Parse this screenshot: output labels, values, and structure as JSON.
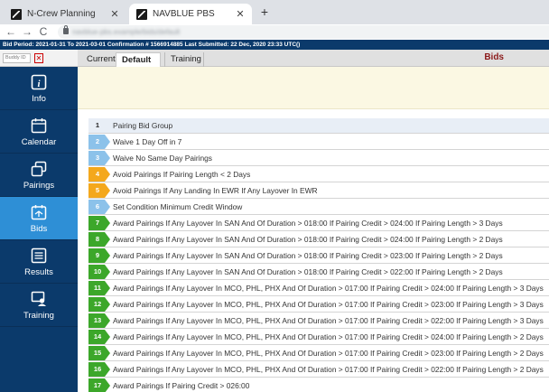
{
  "browser": {
    "tabs": [
      {
        "title": "N-Crew Planning",
        "close": "✕",
        "active": false
      },
      {
        "title": "NAVBLUE PBS",
        "close": "✕",
        "active": true
      }
    ],
    "new_tab": "+",
    "nav": {
      "back": "←",
      "forward": "→",
      "reload": "C"
    },
    "url": "navblue-pbs.example/bids/default"
  },
  "banner": "Bid Period: 2021-01-31 To 2021-03-01 Confirmation # 1566914885 Last Submitted: 22 Dec, 2020 23:33 UTC()",
  "buddy": {
    "placeholder": "Buddy ID",
    "clear": "✕"
  },
  "sidebar": {
    "items": [
      {
        "label": "Info",
        "icon": "info-icon",
        "active": false
      },
      {
        "label": "Calendar",
        "icon": "calendar-icon",
        "active": false
      },
      {
        "label": "Pairings",
        "icon": "pairings-icon",
        "active": false
      },
      {
        "label": "Bids",
        "icon": "bids-icon",
        "active": true
      },
      {
        "label": "Results",
        "icon": "results-icon",
        "active": false
      },
      {
        "label": "Training",
        "icon": "training-icon",
        "active": false
      }
    ]
  },
  "main": {
    "tabs": [
      {
        "label": "Current",
        "active": false
      },
      {
        "label": "Default",
        "active": true
      },
      {
        "label": "Training",
        "active": false
      }
    ],
    "section_title": "Bids"
  },
  "colors": {
    "blue": "#8cc2ea",
    "orange": "#f4a81d",
    "green": "#3ca72a",
    "navy": "#0b3a6b",
    "active_nav": "#2e8fd6"
  },
  "bids": [
    {
      "num": "1",
      "text": "Pairing Bid Group",
      "color": "plain"
    },
    {
      "num": "2",
      "text": "Waive 1 Day Off in 7",
      "color": "blue"
    },
    {
      "num": "3",
      "text": "Waive No Same Day Pairings",
      "color": "blue"
    },
    {
      "num": "4",
      "text": "Avoid Pairings If Pairing Length < 2 Days",
      "color": "orange"
    },
    {
      "num": "5",
      "text": "Avoid Pairings If Any Landing In EWR If Any Layover In EWR",
      "color": "orange"
    },
    {
      "num": "6",
      "text": "Set Condition Minimum Credit Window",
      "color": "blue"
    },
    {
      "num": "7",
      "text": "Award Pairings If Any Layover In SAN And Of Duration > 018:00 If Pairing Credit > 024:00 If Pairing Length > 3 Days",
      "color": "green"
    },
    {
      "num": "8",
      "text": "Award Pairings If Any Layover In SAN And Of Duration > 018:00 If Pairing Credit > 024:00 If Pairing Length > 2 Days",
      "color": "green"
    },
    {
      "num": "9",
      "text": "Award Pairings If Any Layover In SAN And Of Duration > 018:00 If Pairing Credit > 023:00 If Pairing Length > 2 Days",
      "color": "green"
    },
    {
      "num": "10",
      "text": "Award Pairings If Any Layover In SAN And Of Duration > 018:00 If Pairing Credit > 022:00 If Pairing Length > 2 Days",
      "color": "green"
    },
    {
      "num": "11",
      "text": "Award Pairings If Any Layover In MCO, PHL, PHX And Of Duration > 017:00 If Pairing Credit > 024:00 If Pairing Length > 3 Days",
      "color": "green"
    },
    {
      "num": "12",
      "text": "Award Pairings If Any Layover In MCO, PHL, PHX And Of Duration > 017:00 If Pairing Credit > 023:00 If Pairing Length > 3 Days",
      "color": "green"
    },
    {
      "num": "13",
      "text": "Award Pairings If Any Layover In MCO, PHL, PHX And Of Duration > 017:00 If Pairing Credit > 022:00 If Pairing Length > 3 Days",
      "color": "green"
    },
    {
      "num": "14",
      "text": "Award Pairings If Any Layover In MCO, PHL, PHX And Of Duration > 017:00 If Pairing Credit > 024:00 If Pairing Length > 2 Days",
      "color": "green"
    },
    {
      "num": "15",
      "text": "Award Pairings If Any Layover In MCO, PHL, PHX And Of Duration > 017:00 If Pairing Credit > 023:00 If Pairing Length > 2 Days",
      "color": "green"
    },
    {
      "num": "16",
      "text": "Award Pairings If Any Layover In MCO, PHL, PHX And Of Duration > 017:00 If Pairing Credit > 022:00 If Pairing Length > 2 Days",
      "color": "green"
    },
    {
      "num": "17",
      "text": "Award Pairings If Pairing Credit > 026:00",
      "color": "green"
    }
  ]
}
